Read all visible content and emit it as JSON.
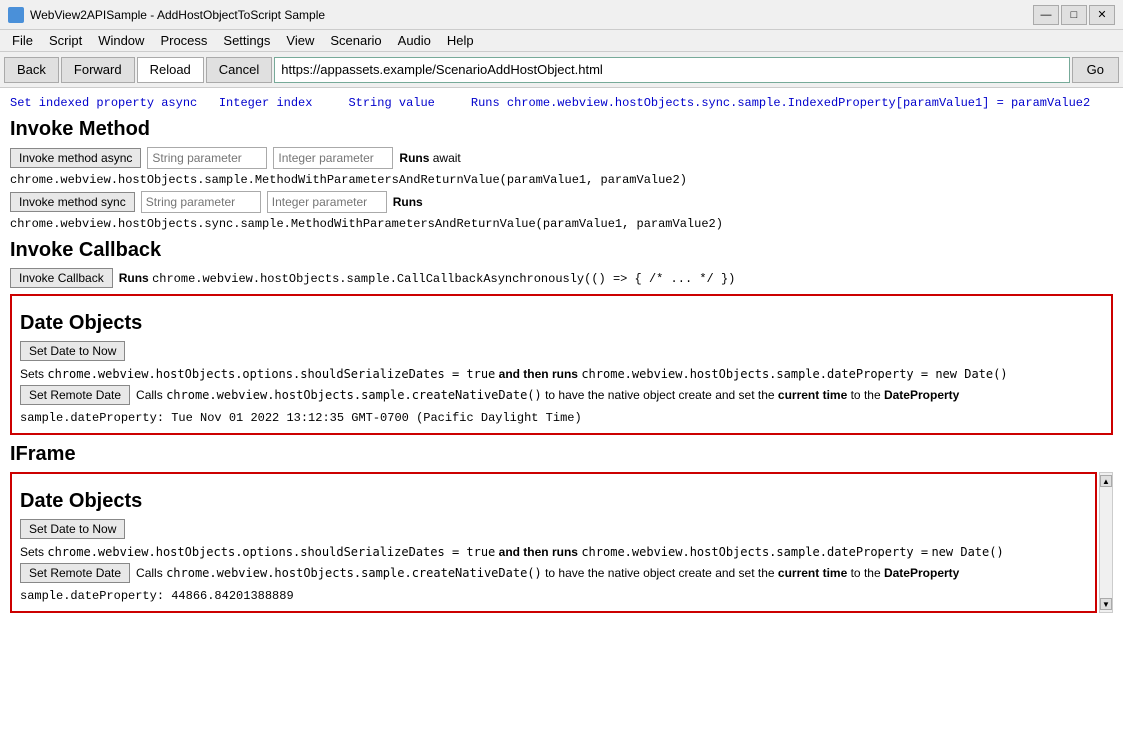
{
  "titleBar": {
    "icon": "webview-icon",
    "title": "WebView2APISample - AddHostObjectToScript Sample",
    "controls": {
      "minimize": "—",
      "maximize": "□",
      "close": "✕"
    }
  },
  "menuBar": {
    "items": [
      "File",
      "Script",
      "Window",
      "Process",
      "Settings",
      "View",
      "Scenario",
      "Audio",
      "Help"
    ]
  },
  "navBar": {
    "back_label": "Back",
    "forward_label": "Forward",
    "reload_label": "Reload",
    "cancel_label": "Cancel",
    "url": "https://appassets.example/ScenarioAddHostObject.html",
    "go_label": "Go"
  },
  "content": {
    "truncated_top": "Set indexed property async  Integer index   String value   Runs chrome.webview.hostObjects.sync.sample.IndexedProperty[paramValue1] = paramValue2",
    "invokeMethod": {
      "title": "Invoke Method",
      "asyncBtn": "Invoke method async",
      "asyncParam1": "String parameter",
      "asyncParam2": "Integer parameter",
      "asyncRuns": "Runs await",
      "asyncCode": "chrome.webview.hostObjects.sample.MethodWithParametersAndReturnValue(paramValue1, paramValue2)",
      "syncBtn": "Invoke method sync",
      "syncParam1": "String parameter",
      "syncParam2": "Integer parameter",
      "syncRuns": "Runs",
      "syncCode": "chrome.webview.hostObjects.sync.sample.MethodWithParametersAndReturnValue(paramValue1, paramValue2)"
    },
    "invokeCallback": {
      "title": "Invoke Callback",
      "btn": "Invoke Callback",
      "runs_label": "Runs",
      "code": "chrome.webview.hostObjects.sample.CallCallbackAsynchronously(() => { /* ... */ })"
    },
    "dateObjects": {
      "title": "Date Objects",
      "setDateBtn": "Set Date to Now",
      "setDateDesc1": "Sets",
      "setDateCode1": "chrome.webview.hostObjects.options.shouldSerializeDates = true",
      "setDateDesc2": "and then runs",
      "setDateCode2": "chrome.webview.hostObjects.sample.dateProperty = new Date()",
      "setRemoteBtn": "Set Remote Date",
      "setRemoteDesc": "Calls",
      "setRemoteCode": "chrome.webview.hostObjects.sample.createNativeDate()",
      "setRemoteDesc2": "to have the native object create and set the",
      "setRemoteHighlight1": "current time",
      "setRemoteDesc3": "to the",
      "setRemoteHighlight2": "DateProperty",
      "status": "sample.dateProperty: Tue Nov 01 2022 13:12:35 GMT-0700 (Pacific Daylight Time)"
    },
    "iframe": {
      "title": "IFrame",
      "dateObjects": {
        "title": "Date Objects",
        "setDateBtn": "Set Date to Now",
        "setDateDesc1": "Sets",
        "setDateCode1": "chrome.webview.hostObjects.options.shouldSerializeDates = true",
        "setDateDesc2": "and then runs",
        "setDateCode2": "chrome.webview.hostObjects.sample.dateProperty =",
        "setDateCode3": "new Date()",
        "setRemoteBtn": "Set Remote Date",
        "setRemoteDesc": "Calls",
        "setRemoteCode": "chrome.webview.hostObjects.sample.createNativeDate()",
        "setRemoteDesc2": "to have the native object create and set the",
        "setRemoteHighlight1": "current time",
        "setRemoteDesc3": "to the",
        "setRemoteHighlight2": "DateProperty",
        "status": "sample.dateProperty: 44866.84201388889"
      }
    }
  }
}
